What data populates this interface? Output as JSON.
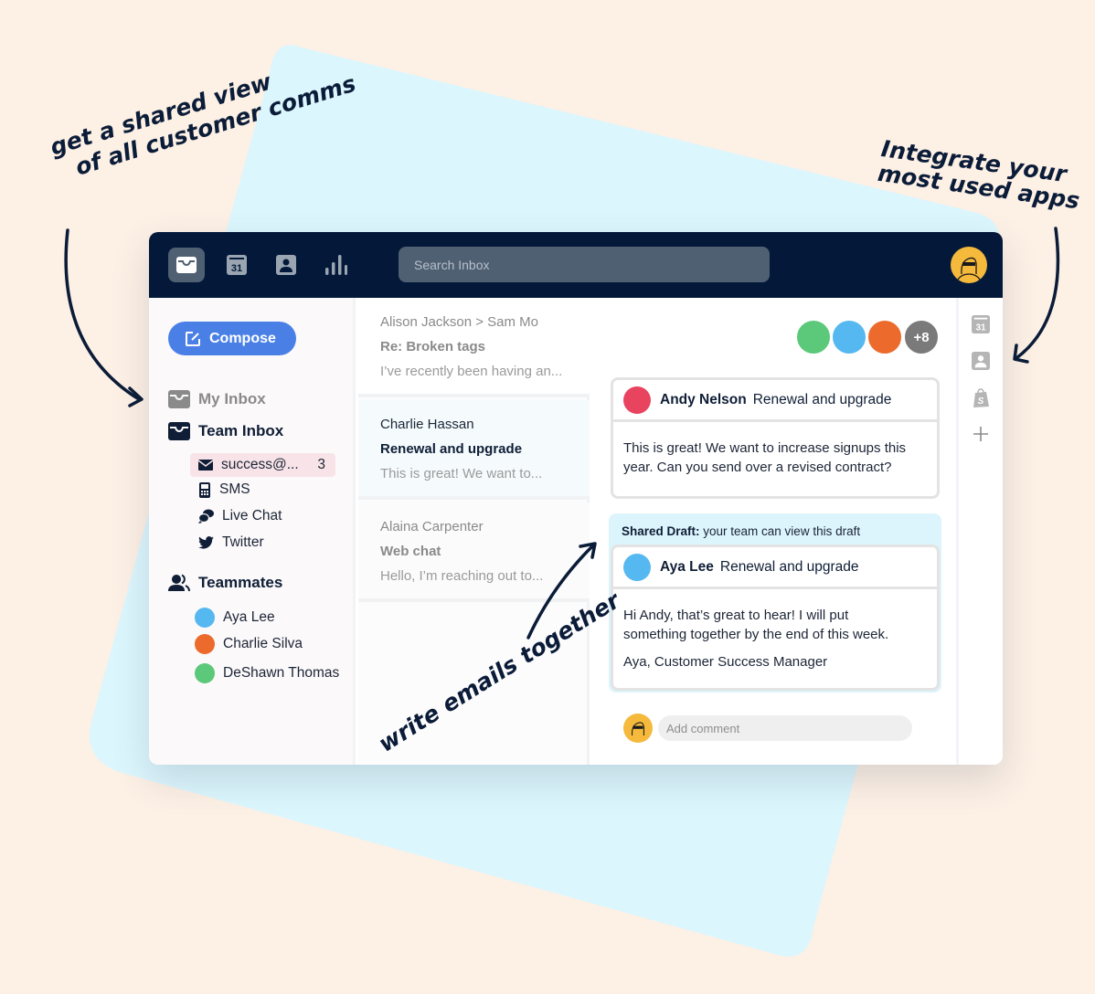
{
  "annotations": {
    "shared_view": [
      "get a shared view",
      "of all customer comms"
    ],
    "integrate": [
      "Integrate your",
      "most used apps"
    ],
    "write_together": "write emails together"
  },
  "colors": {
    "background": "#fdf0e5",
    "backdrop_shape": "#dcf6fd",
    "topbar": "#04193a",
    "accent": "#4a80e6",
    "highlight": "#f8e4e8",
    "draft_bg": "#dcf4fc"
  },
  "topbar": {
    "nav": [
      {
        "name": "inbox",
        "icon": "inbox-icon",
        "active": true
      },
      {
        "name": "calendar",
        "icon": "calendar-icon",
        "label": "31"
      },
      {
        "name": "contacts",
        "icon": "contact-card-icon"
      },
      {
        "name": "analytics",
        "icon": "bar-chart-icon"
      }
    ],
    "search_placeholder": "Search Inbox"
  },
  "sidebar": {
    "compose_label": "Compose",
    "my_inbox": "My Inbox",
    "team_inbox": "Team Inbox",
    "channels": [
      {
        "label": "success@...",
        "count": "3",
        "icon": "envelope-icon",
        "selected": true
      },
      {
        "label": "SMS",
        "icon": "phone-icon"
      },
      {
        "label": "Live Chat",
        "icon": "chat-bubbles-icon"
      },
      {
        "label": "Twitter",
        "icon": "twitter-icon"
      }
    ],
    "teammates_label": "Teammates",
    "teammates": [
      {
        "name": "Aya Lee",
        "color": "#56b8f0"
      },
      {
        "name": "Charlie Silva",
        "color": "#ec6a2c"
      },
      {
        "name": "DeShawn Thomas",
        "color": "#5cc87a"
      }
    ]
  },
  "conversations": [
    {
      "from": "Alison Jackson > Sam Mo",
      "subject": "Re: Broken tags",
      "preview": "I’ve recently been having an..."
    },
    {
      "from": "Charlie Hassan",
      "subject": "Renewal and upgrade",
      "preview": "This is great! We want to...",
      "selected": true
    },
    {
      "from": "Alaina Carpenter",
      "subject": "Web chat",
      "preview": "Hello, I’m reaching out to..."
    }
  ],
  "detail": {
    "participants": [
      {
        "color": "#5cc87a"
      },
      {
        "color": "#56b8f0"
      },
      {
        "color": "#ec6a2c"
      }
    ],
    "participants_more": "+8",
    "message": {
      "sender": "Andy Nelson",
      "subject": "Renewal and upgrade",
      "avatar_color": "#e8435f",
      "body_lines": [
        "This is great! We want to increase signups this",
        "year. Can you send over a revised contract?"
      ]
    },
    "draft": {
      "label_bold": "Shared Draft:",
      "label_rest": " your team can view this draft",
      "sender": "Aya Lee",
      "subject": "Renewal and upgrade",
      "avatar_color": "#56b8f0",
      "body_lines": [
        "Hi Andy, that’s great to hear! I will put",
        "something together by the end of this week."
      ],
      "signature": "Aya, Customer Success Manager"
    },
    "comment_placeholder": "Add comment",
    "user_avatar_color": "#f5b93c"
  },
  "apps_rail": {
    "items": [
      {
        "icon": "calendar-icon",
        "label": "31"
      },
      {
        "icon": "contact-card-icon"
      },
      {
        "icon": "shopify-bag-icon",
        "label": "S"
      },
      {
        "icon": "plus-icon",
        "label": "+"
      }
    ]
  }
}
